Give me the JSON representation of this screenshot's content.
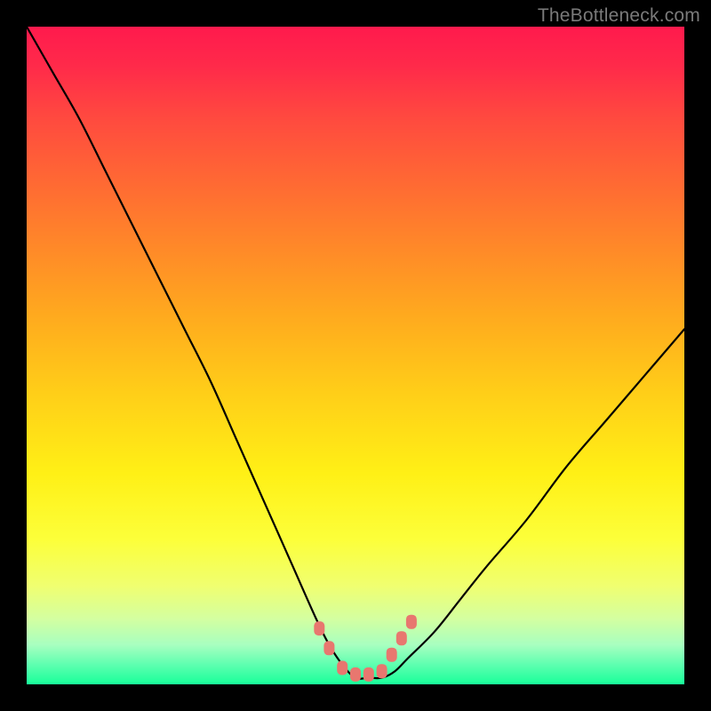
{
  "watermark": "TheBottleneck.com",
  "colors": {
    "frame": "#000000",
    "curve_stroke": "#000000",
    "marker_fill": "#e8776f",
    "marker_stroke": "#e8776f",
    "watermark": "#7a7a7a",
    "gradient_stops": [
      "#ff1a4d",
      "#ff2a4a",
      "#ff4a3f",
      "#ff6a33",
      "#ff8a28",
      "#ffaa1e",
      "#ffcf18",
      "#fff016",
      "#fcff3a",
      "#f0ff70",
      "#d4ffa0",
      "#a8ffc0",
      "#5effb0",
      "#18ff9a"
    ]
  },
  "chart_data": {
    "type": "line",
    "title": "",
    "xlabel": "",
    "ylabel": "",
    "xlim": [
      0,
      100
    ],
    "ylim": [
      0,
      100
    ],
    "note": "V-shaped bottleneck curve with flat valley; x and y are in abstract 0-100 plot units (origin at lower-left of gradient area). Read off from pixel positions, no axes shown.",
    "series": [
      {
        "name": "bottleneck-curve",
        "x": [
          0,
          4,
          8,
          12,
          16,
          20,
          24,
          28,
          32,
          36,
          40,
          44,
          46,
          48,
          50,
          52,
          54,
          56,
          58,
          62,
          66,
          70,
          76,
          82,
          88,
          94,
          100
        ],
        "y": [
          100,
          93,
          86,
          78,
          70,
          62,
          54,
          46,
          37,
          28,
          19,
          10,
          6,
          3,
          1,
          1,
          1,
          2,
          4,
          8,
          13,
          18,
          25,
          33,
          40,
          47,
          54
        ]
      }
    ],
    "markers": {
      "name": "valley-markers",
      "shape": "rounded-square",
      "x": [
        44.5,
        46,
        48,
        50,
        52,
        54,
        55.5,
        57,
        58.5
      ],
      "y": [
        8.5,
        5.5,
        2.5,
        1.5,
        1.5,
        2.0,
        4.5,
        7.0,
        9.5
      ]
    }
  }
}
